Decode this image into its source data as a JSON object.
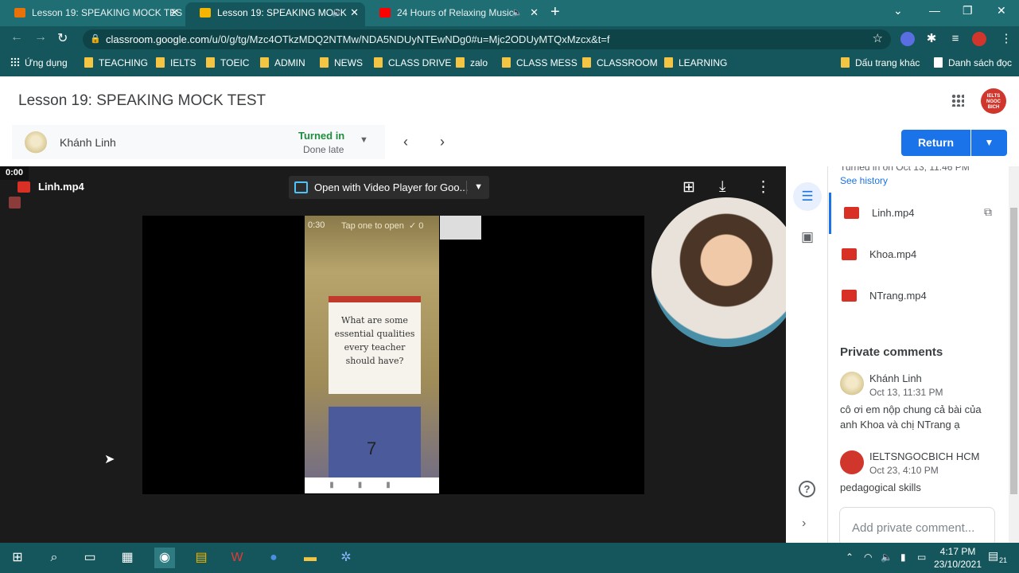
{
  "browser": {
    "tabs": [
      {
        "label": "Lesson 19: SPEAKING MOCK TES",
        "active": false
      },
      {
        "label": "Lesson 19: SPEAKING MOCK",
        "active": true
      },
      {
        "label": "24 Hours of Relaxing Music -",
        "active": false
      }
    ],
    "url_host": "classroom.google.com",
    "url_path": "/u/0/g/tg/Mzc4OTkzMDQ2NTMw/NDA5NDUyNTEwNDg0#u=Mjc2ODUyMTQxMzcx&t=f",
    "bookmarks": [
      "Ứng dụng",
      "TEACHING",
      "IELTS",
      "TOEIC",
      "ADMIN",
      "NEWS",
      "CLASS DRIVE",
      "zalo",
      "CLASS MESS",
      "CLASSROOM",
      "LEARNING"
    ],
    "bookmarks_right": [
      "Dấu trang khác",
      "Danh sách đọc"
    ]
  },
  "header": {
    "title": "Lesson 19: SPEAKING MOCK TEST",
    "profile_text": "IELTS NGOC BICH"
  },
  "student": {
    "name": "Khánh Linh",
    "status": "Turned in",
    "substatus": "Done late"
  },
  "actions": {
    "return_label": "Return"
  },
  "viewer": {
    "time_badge": "0:00",
    "filename": "Linh.mp4",
    "open_with": "Open with Video Player for Goo...",
    "phone_time": "0:30",
    "phone_hint": "Tap one to open",
    "phone_count": "✓ 0",
    "card_question": "What are some essential qualities every teacher should have?",
    "card_number": "7"
  },
  "panel": {
    "history_top": "Turned in on Oct 13, 11:46 PM",
    "see_history": "See history",
    "files": [
      "Linh.mp4",
      "Khoa.mp4",
      "NTrang.mp4"
    ],
    "private_comments_title": "Private comments",
    "comments": [
      {
        "name": "Khánh Linh",
        "date": "Oct 13, 11:31 PM",
        "text": "cô ơi em nộp chung cả bài của anh Khoa và chị NTrang ạ"
      },
      {
        "name": "IELTSNGOCBICH HCM",
        "date": "Oct 23, 4:10 PM",
        "text": "pedagogical skills"
      }
    ],
    "add_comment_placeholder": "Add private comment..."
  },
  "taskbar": {
    "time": "4:17 PM",
    "date": "23/10/2021",
    "notif_count": "21"
  },
  "colors": {
    "chrome_theme": "#14565b",
    "accent": "#1a73e8",
    "turned_in": "#1e8e3e"
  }
}
